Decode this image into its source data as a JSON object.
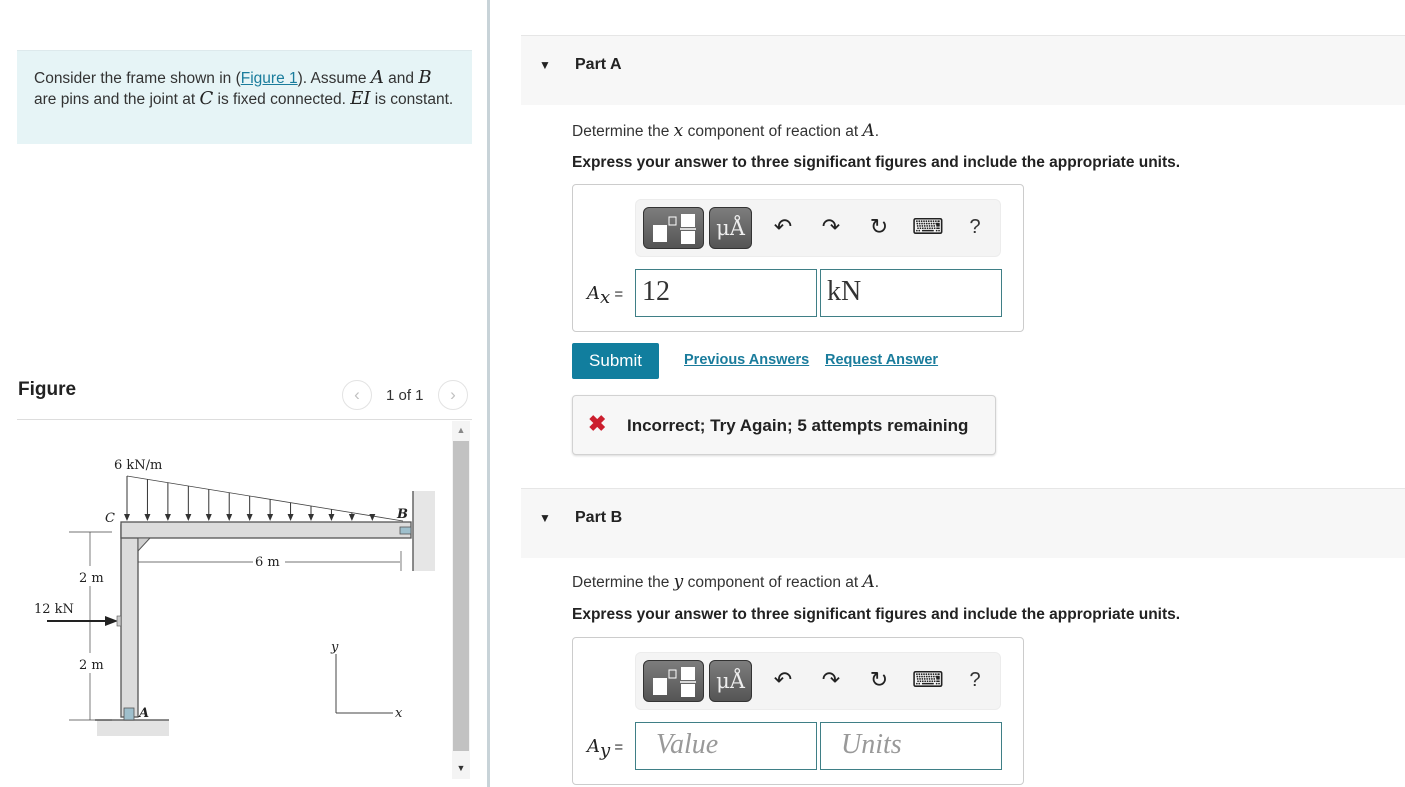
{
  "intro": {
    "text_1": "Consider the frame shown in (",
    "figure_link": "Figure 1",
    "text_2": "). Assume ",
    "var_a": "A",
    "text_3": " and ",
    "var_b": "B",
    "text_4": " are pins and the joint at ",
    "var_c": "C",
    "text_5": " is fixed connected. ",
    "var_ei": "EI",
    "text_6": " is constant."
  },
  "figure": {
    "title": "Figure",
    "pager": {
      "prev_icon": "‹",
      "count": "1 of 1",
      "next_icon": "›"
    },
    "labels": {
      "load": "6 kN/m",
      "joint_c": "C",
      "joint_b": "B",
      "joint_a": "A",
      "span": "6 m",
      "height_upper": "2 m",
      "height_lower": "2 m",
      "point_load": "12 kN",
      "axis_x": "x",
      "axis_y": "y"
    },
    "scroll": {
      "up_icon": "▲",
      "down_icon": "▼"
    }
  },
  "parts": [
    {
      "caret": "▼",
      "label": "Part A",
      "question_pre": "Determine the ",
      "question_var": "x",
      "question_mid": " component of reaction at ",
      "question_point": "A",
      "question_end": ".",
      "instruction": "Express your answer to three significant figures and include the appropriate units.",
      "var_main": "A",
      "var_sub": "x",
      "equals": "=",
      "value": "12",
      "units": "kN",
      "submit_label": "Submit",
      "previous_answers": "Previous Answers",
      "request_answer": "Request Answer",
      "feedback_icon": "✖",
      "feedback": "Incorrect; Try Again; 5 attempts remaining"
    },
    {
      "caret": "▼",
      "label": "Part B",
      "question_pre": "Determine the ",
      "question_var": "y",
      "question_mid": " component of reaction at ",
      "question_point": "A",
      "question_end": ".",
      "instruction": "Express your answer to three significant figures and include the appropriate units.",
      "var_main": "A",
      "var_sub": "y",
      "equals": "=",
      "value_placeholder": "Value",
      "units_placeholder": "Units"
    }
  ],
  "toolbar": {
    "symbols_label": "μÅ",
    "undo_icon": "↶",
    "redo_icon": "↷",
    "reset_icon": "↻",
    "keyboard_icon": "⌨",
    "help_label": "?"
  },
  "colors": {
    "accent": "#117e9e",
    "link": "#1a7c9c",
    "error": "#cc1f2e",
    "intro_bg": "#e6f4f6"
  }
}
